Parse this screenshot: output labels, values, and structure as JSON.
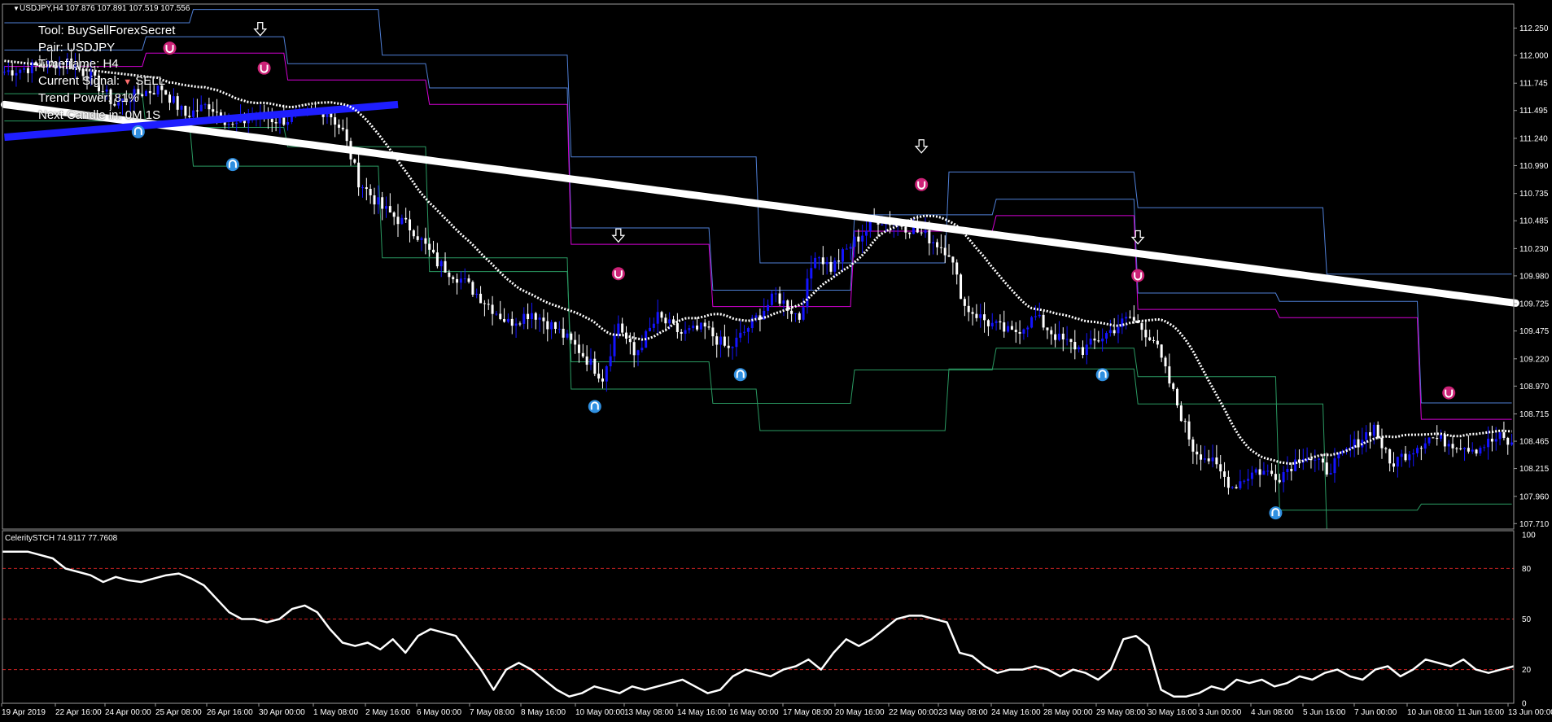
{
  "window": {
    "title_line": "USDJPY,H4  107.876 107.891 107.519 107.556",
    "symbol_menu_icon": "triangle-down-icon"
  },
  "info_panel": {
    "tool": "Tool: BuySellForexSecret",
    "pair": "Pair: USDJPY",
    "timeframe": "Timeframe: H4",
    "signal_prefix": "Current Signal: ",
    "signal_icon": "triangle-down-icon",
    "signal_value": " SELL",
    "trend_power": "Trend Power: 81%",
    "next_candle": "Next Candle in: 0M 1S"
  },
  "oscillator": {
    "title_line": "CeleritySTCH 74.9117 77.7608"
  },
  "colors": {
    "background": "#000000",
    "bull_candle": "#1414ff",
    "bear_candle": "#ffffff",
    "upper_band": "#4f7fd6",
    "lower_band": "#2a9a62",
    "mid_band": "#d400d4",
    "buy_marker": "#2f8fe0",
    "sell_marker": "#cc2277",
    "level_line": "#cc2222"
  },
  "chart_data": [
    {
      "type": "candlestick",
      "name": "USDJPY,H4",
      "y_ticks": [
        "112.250",
        "112.000",
        "111.745",
        "111.495",
        "111.240",
        "110.990",
        "110.735",
        "110.485",
        "110.230",
        "109.980",
        "109.725",
        "109.475",
        "109.220",
        "108.970",
        "108.715",
        "108.465",
        "108.215",
        "107.960",
        "107.710"
      ],
      "ylim": [
        107.66,
        112.47
      ],
      "x_ticks": [
        "19 Apr 2019",
        "22 Apr 16:00",
        "24 Apr 00:00",
        "25 Apr 08:00",
        "26 Apr 16:00",
        "30 Apr 00:00",
        "1 May 08:00",
        "2 May 16:00",
        "6 May 00:00",
        "7 May 08:00",
        "8 May 16:00",
        "10 May 00:00",
        "13 May 08:00",
        "14 May 16:00",
        "16 May 00:00",
        "17 May 08:00",
        "20 May 16:00",
        "22 May 00:00",
        "23 May 08:00",
        "24 May 16:00",
        "28 May 00:00",
        "29 May 08:00",
        "30 May 16:00",
        "3 Jun 00:00",
        "4 Jun 08:00",
        "5 Jun 16:00",
        "7 Jun 00:00",
        "10 Jun 08:00",
        "11 Jun 16:00",
        "13 Jun 00:00"
      ],
      "close_path": [
        [
          0,
          111.85
        ],
        [
          8,
          111.9
        ],
        [
          16,
          111.95
        ],
        [
          22,
          111.8
        ],
        [
          28,
          111.55
        ],
        [
          34,
          111.65
        ],
        [
          40,
          111.7
        ],
        [
          46,
          111.45
        ],
        [
          52,
          111.55
        ],
        [
          58,
          111.35
        ],
        [
          64,
          111.45
        ],
        [
          70,
          111.4
        ],
        [
          76,
          111.45
        ],
        [
          82,
          111.5
        ],
        [
          86,
          111.3
        ],
        [
          90,
          110.85
        ],
        [
          96,
          110.6
        ],
        [
          104,
          110.4
        ],
        [
          110,
          110.1
        ],
        [
          116,
          109.95
        ],
        [
          122,
          109.75
        ],
        [
          128,
          109.55
        ],
        [
          134,
          109.65
        ],
        [
          140,
          109.5
        ],
        [
          146,
          109.3
        ],
        [
          152,
          109.05
        ],
        [
          156,
          109.55
        ],
        [
          160,
          109.25
        ],
        [
          166,
          109.6
        ],
        [
          172,
          109.45
        ],
        [
          178,
          109.5
        ],
        [
          184,
          109.3
        ],
        [
          190,
          109.55
        ],
        [
          196,
          109.8
        ],
        [
          202,
          109.6
        ],
        [
          206,
          110.2
        ],
        [
          210,
          110.05
        ],
        [
          216,
          110.3
        ],
        [
          222,
          110.5
        ],
        [
          228,
          110.45
        ],
        [
          234,
          110.35
        ],
        [
          240,
          110.2
        ],
        [
          244,
          109.7
        ],
        [
          250,
          109.55
        ],
        [
          256,
          109.45
        ],
        [
          262,
          109.6
        ],
        [
          268,
          109.4
        ],
        [
          274,
          109.3
        ],
        [
          280,
          109.45
        ],
        [
          286,
          109.6
        ],
        [
          292,
          109.4
        ],
        [
          296,
          109.0
        ],
        [
          302,
          108.4
        ],
        [
          306,
          108.3
        ],
        [
          312,
          108.05
        ],
        [
          318,
          108.2
        ],
        [
          324,
          108.15
        ],
        [
          330,
          108.35
        ],
        [
          336,
          108.2
        ],
        [
          342,
          108.4
        ],
        [
          348,
          108.6
        ],
        [
          352,
          108.25
        ],
        [
          356,
          108.35
        ],
        [
          362,
          108.5
        ],
        [
          368,
          108.45
        ],
        [
          374,
          108.4
        ],
        [
          380,
          108.5
        ],
        [
          384,
          108.4
        ]
      ],
      "n_bars": 384,
      "moving_averages": [
        {
          "style": "dotted-white",
          "start": 111.95,
          "end": 108.5
        },
        {
          "style": "thick-white",
          "start": 111.55,
          "end": 109.73
        },
        {
          "style": "thick-blue",
          "start": 111.25,
          "end": 111.55
        }
      ],
      "arrows_down_bar": [
        65,
        156,
        233,
        288
      ],
      "sell_markers_bar": [
        42,
        66,
        156,
        233,
        288,
        367
      ],
      "buy_markers_bar": [
        34,
        58,
        150,
        187,
        279,
        323
      ]
    },
    {
      "type": "line",
      "name": "CeleritySTCH",
      "y_ticks": [
        "100",
        "80",
        "50",
        "20",
        "0"
      ],
      "ylim": [
        0,
        100
      ],
      "levels": [
        80,
        50,
        20
      ],
      "values": [
        90,
        90,
        90,
        88,
        86,
        80,
        78,
        76,
        72,
        75,
        73,
        72,
        74,
        76,
        77,
        74,
        70,
        62,
        54,
        50,
        50,
        48,
        50,
        56,
        58,
        54,
        44,
        36,
        34,
        36,
        32,
        38,
        30,
        40,
        44,
        42,
        40,
        30,
        20,
        8,
        20,
        24,
        20,
        14,
        8,
        4,
        6,
        10,
        8,
        6,
        10,
        8,
        10,
        12,
        14,
        10,
        6,
        8,
        16,
        20,
        18,
        16,
        20,
        22,
        26,
        20,
        30,
        38,
        34,
        38,
        44,
        50,
        52,
        52,
        50,
        48,
        30,
        28,
        22,
        18,
        20,
        20,
        22,
        20,
        16,
        20,
        18,
        14,
        20,
        38,
        40,
        34,
        8,
        4,
        4,
        6,
        10,
        8,
        14,
        12,
        14,
        10,
        12,
        16,
        14,
        18,
        20,
        16,
        14,
        20,
        22,
        16,
        20,
        26,
        24,
        22,
        26,
        20,
        18,
        20,
        22
      ]
    }
  ]
}
